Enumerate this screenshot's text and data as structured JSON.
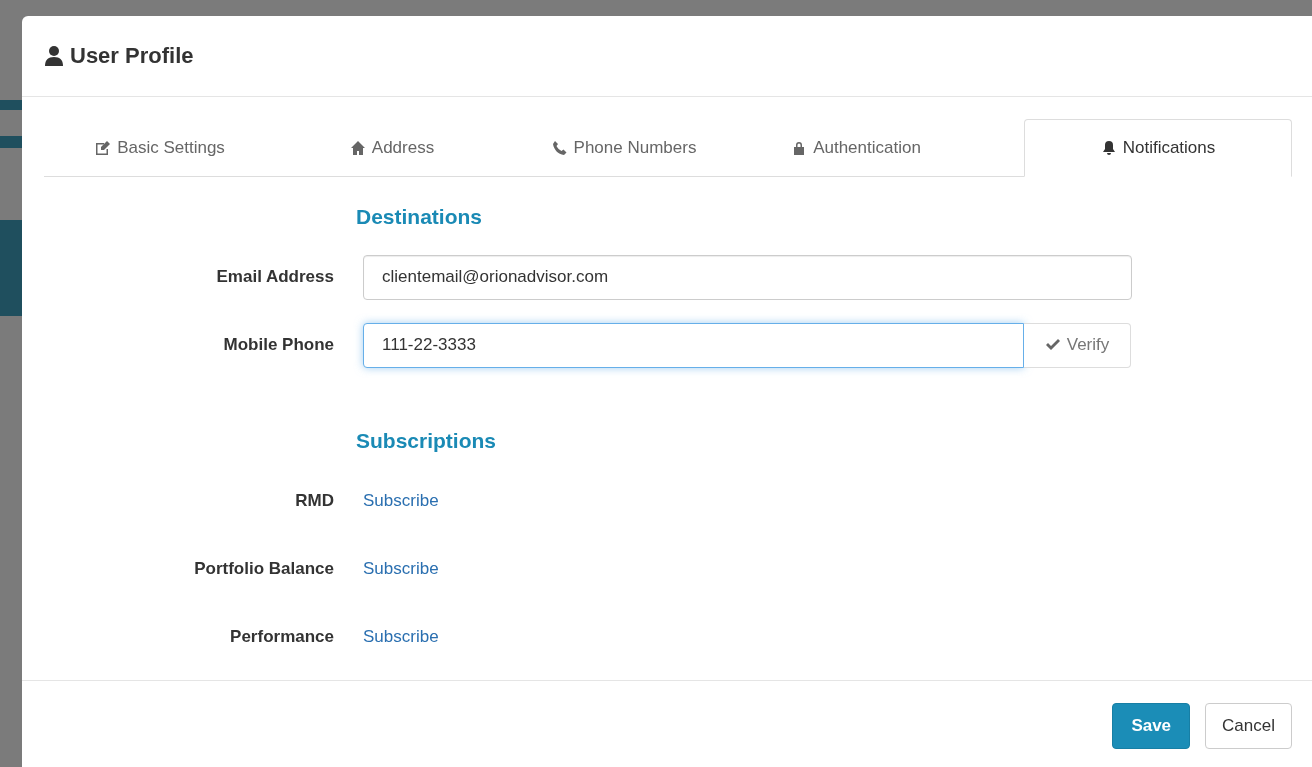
{
  "dialog": {
    "title": "User Profile"
  },
  "tabs": [
    {
      "kind": "edit",
      "label": "Basic Settings",
      "selected": false
    },
    {
      "kind": "home",
      "label": "Address",
      "selected": false
    },
    {
      "kind": "phone",
      "label": "Phone Numbers",
      "selected": false
    },
    {
      "kind": "lock",
      "label": "Authentication",
      "selected": false
    },
    {
      "kind": "bell",
      "label": "Notifications",
      "selected": true
    }
  ],
  "destinations": {
    "heading": "Destinations",
    "fields": [
      {
        "label": "Email Address",
        "value": "clientemail@orionadvisor.com",
        "focused": false
      },
      {
        "label": "Mobile Phone",
        "value": "111-22-3333",
        "focused": true,
        "action": "Verify"
      }
    ]
  },
  "subscriptions": {
    "heading": "Subscriptions",
    "items": [
      {
        "label": "RMD",
        "link": "Subscribe"
      },
      {
        "label": "Portfolio Balance",
        "link": "Subscribe"
      },
      {
        "label": "Performance",
        "link": "Subscribe"
      }
    ]
  },
  "footer": {
    "buttons": [
      {
        "label": "Save",
        "kind": "primary"
      },
      {
        "label": "Cancel",
        "kind": "default"
      }
    ]
  }
}
